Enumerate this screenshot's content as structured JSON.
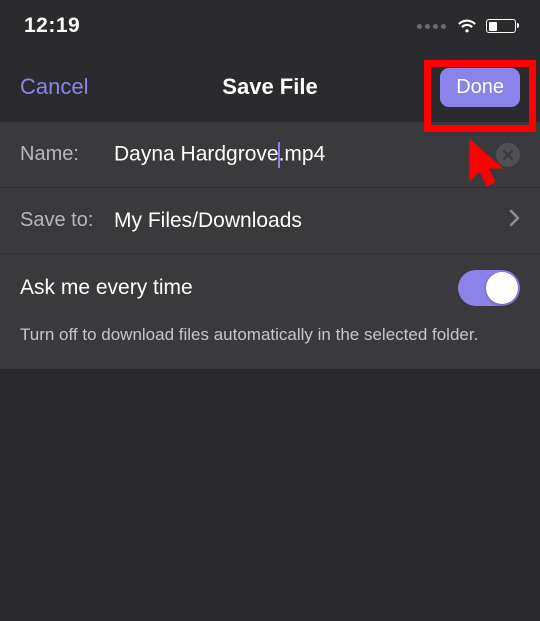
{
  "status": {
    "time": "12:19"
  },
  "nav": {
    "cancel": "Cancel",
    "title": "Save File",
    "done": "Done"
  },
  "fields": {
    "name_label": "Name:",
    "name_value_pre": "Dayna Hardgrove",
    "name_value_post": ".mp4",
    "saveto_label": "Save to:",
    "saveto_value": "My Files/Downloads"
  },
  "toggle": {
    "label": "Ask me every time",
    "on": true,
    "hint": "Turn off to download files automatically in the selected folder."
  }
}
